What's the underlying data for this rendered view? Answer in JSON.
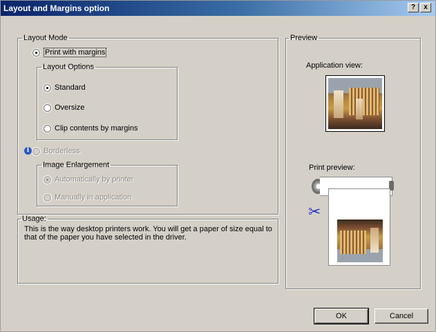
{
  "window": {
    "title": "Layout and Margins option",
    "help_label": "?",
    "close_label": "x"
  },
  "layout_mode": {
    "legend": "Layout Mode",
    "print_with_margins": {
      "label": "Print with margins",
      "checked": true
    },
    "layout_options": {
      "legend": "Layout Options",
      "options": [
        {
          "label": "Standard",
          "checked": true
        },
        {
          "label": "Oversize",
          "checked": false
        },
        {
          "label": "Clip contents by margins",
          "checked": false
        }
      ]
    },
    "borderless": {
      "label": "Borderless",
      "checked": false,
      "disabled": true
    },
    "image_enlargement": {
      "legend": "Image Enlargement",
      "disabled": true,
      "options": [
        {
          "label": "Automatically by printer",
          "checked": true
        },
        {
          "label": "Manually in application",
          "checked": false
        }
      ]
    }
  },
  "usage": {
    "legend": "Usage:",
    "text": "This is the way desktop printers work. You will get a paper of size equal to that of the paper you have selected in the driver."
  },
  "preview": {
    "legend": "Preview",
    "application_view_label": "Application view:",
    "print_preview_label": "Print preview:"
  },
  "icons": {
    "info": "info-icon",
    "scissors": "scissors-icon",
    "scissors_glyph": "✂"
  },
  "buttons": {
    "ok": "OK",
    "cancel": "Cancel"
  },
  "colors": {
    "titlebar_start": "#0a246a",
    "titlebar_end": "#a6caf0",
    "dialog_bg": "#d4d0c8",
    "scissors": "#2233c8"
  }
}
